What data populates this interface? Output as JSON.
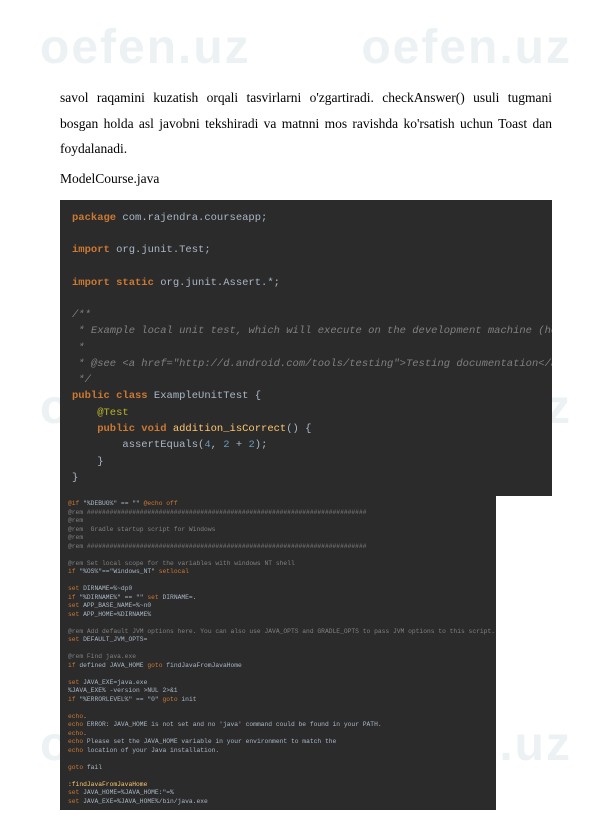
{
  "watermark": "oefen.uz",
  "paragraph": "savol raqamini kuzatish orqali tasvirlarni o'zgartiradi. checkAnswer() usuli tugmani bosgan holda asl javobni tekshiradi va matnni mos ravishda ko'rsatish uchun Toast dan foydalanadi.",
  "filename": "ModelCourse.java",
  "code1": {
    "l1a": "package",
    "l1b": " com.rajendra.courseapp;",
    "l2": " ",
    "l3a": "import",
    "l3b": " org.junit.Test;",
    "l4": " ",
    "l5a": "import static",
    "l5b": " org.junit.Assert.*;",
    "l6": " ",
    "l7": "/**",
    "l8": " * Example local unit test, which will execute on the development machine (host).",
    "l9": " *",
    "l10": " * @see <a href=\"http://d.android.com/tools/testing\">Testing documentation</a>",
    "l11": " */",
    "l12a": "public class",
    "l12b": " ExampleUnitTest {",
    "l13a": "    @Test",
    "l14a": "    public void",
    "l14b": " addition_isCorrect",
    "l14c": "() {",
    "l15a": "        assertEquals(",
    "l15b": "4",
    "l15c": ", ",
    "l15d": "2",
    "l15e": " + ",
    "l15f": "2",
    "l15g": ");",
    "l16": "    }",
    "l17": "}"
  },
  "code2": {
    "l1a": "@if",
    "l1b": " \"%DEBUG%\" == \"\" ",
    "l1c": "@echo off",
    "l2": "@rem ##########################################################################",
    "l3": "@rem",
    "l4": "@rem  Gradle startup script for Windows",
    "l5": "@rem",
    "l6": "@rem ##########################################################################",
    "l7": " ",
    "l8": "@rem Set local scope for the variables with windows NT shell",
    "l9a": "if",
    "l9b": " \"%OS%\"==\"Windows_NT\" ",
    "l9c": "setlocal",
    "l10": " ",
    "l11a": "set",
    "l11b": " DIRNAME=%~dp0",
    "l12a": "if",
    "l12b": " \"%DIRNAME%\" == \"\" ",
    "l12c": "set",
    "l12d": " DIRNAME=.",
    "l13a": "set",
    "l13b": " APP_BASE_NAME=%~n0",
    "l14a": "set",
    "l14b": " APP_HOME=%DIRNAME%",
    "l15": " ",
    "l16": "@rem Add default JVM options here. You can also use JAVA_OPTS and GRADLE_OPTS to pass JVM options to this script.",
    "l17a": "set",
    "l17b": " DEFAULT_JVM_OPTS=",
    "l18": " ",
    "l19": "@rem Find java.exe",
    "l20a": "if",
    "l20b": " defined JAVA_HOME ",
    "l20c": "goto",
    "l20d": " findJavaFromJavaHome",
    "l21": " ",
    "l22a": "set",
    "l22b": " JAVA_EXE=java.exe",
    "l23": "%JAVA_EXE% -version >NUL 2>&1",
    "l24a": "if",
    "l24b": " \"%ERRORLEVEL%\" == \"0\" ",
    "l24c": "goto",
    "l24d": " init",
    "l25": " ",
    "l26a": "echo",
    "l26b": ".",
    "l27a": "echo",
    "l27b": " ERROR: JAVA_HOME is not set and no 'java' command could be found in your PATH.",
    "l28a": "echo",
    "l28b": ".",
    "l29a": "echo",
    "l29b": " Please set the JAVA_HOME variable in your environment to match the",
    "l30a": "echo",
    "l30b": " location of your Java installation.",
    "l31": " ",
    "l32a": "goto",
    "l32b": " fail",
    "l33": " ",
    "l34": ":findJavaFromJavaHome",
    "l35a": "set",
    "l35b": " JAVA_HOME=%JAVA_HOME:\"=%",
    "l36a": "set",
    "l36b": " JAVA_EXE=%JAVA_HOME%/bin/java.exe"
  }
}
